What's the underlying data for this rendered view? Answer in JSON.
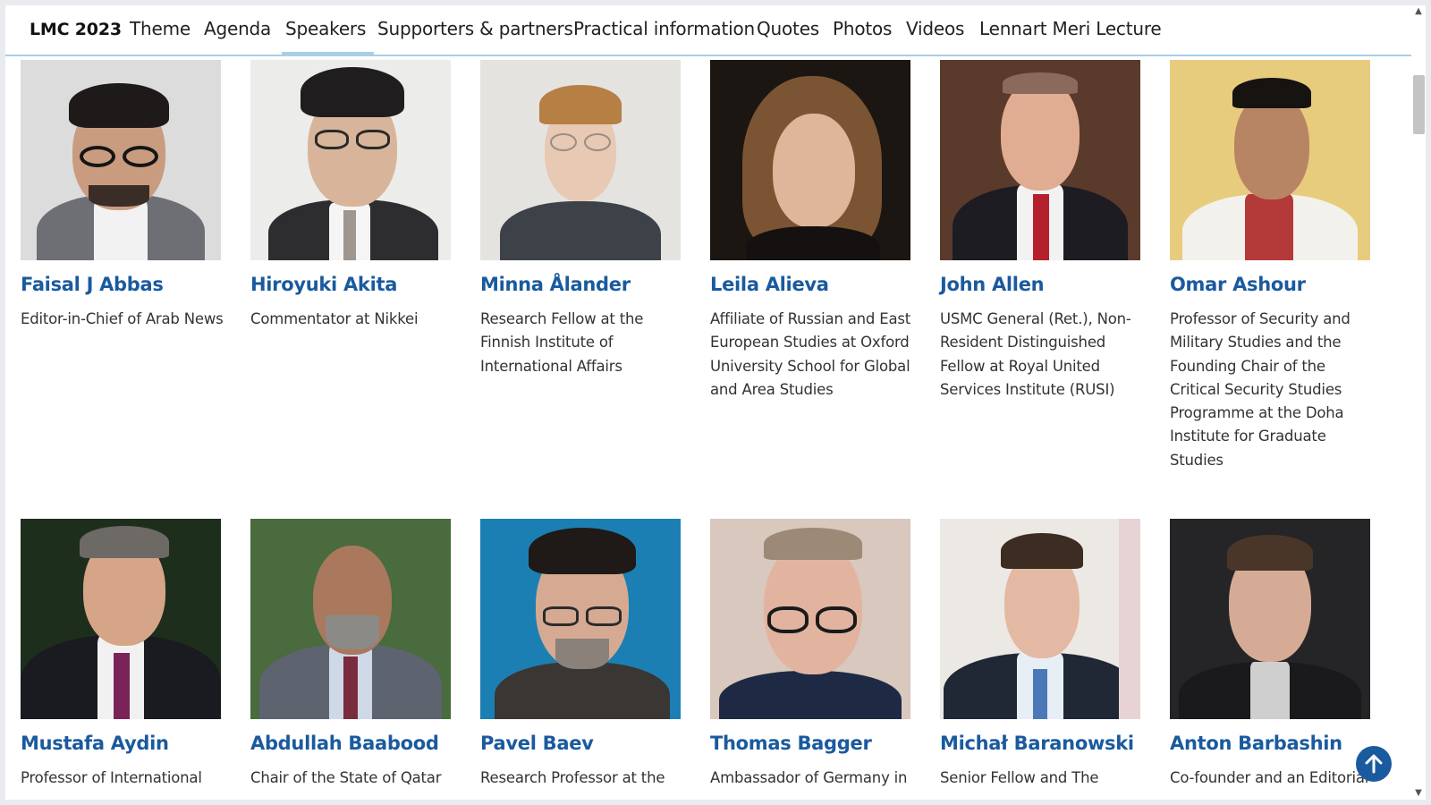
{
  "nav": {
    "brand": "LMC 2023",
    "items": [
      "Theme",
      "Agenda",
      "Speakers",
      "Supporters & partners",
      "Practical information",
      "Quotes",
      "Photos",
      "Videos",
      "Lennart Meri Lecture"
    ],
    "active": "Speakers",
    "accent_color": "#a9cfe8"
  },
  "speakers": [
    {
      "name": "Faisal J Abbas",
      "role": "Editor-in-Chief of Arab News"
    },
    {
      "name": "Hiroyuki Akita",
      "role": "Commentator at Nikkei"
    },
    {
      "name": "Minna Ålander",
      "role": "Research Fellow at the Finnish Institute of International Affairs"
    },
    {
      "name": "Leila Alieva",
      "role": "Affiliate of Russian and East European Studies at Oxford University School for Global and Area Studies"
    },
    {
      "name": "John Allen",
      "role": "USMC General (Ret.), Non-Resident Distinguished Fellow at Royal United Services Institute (RUSI)"
    },
    {
      "name": "Omar Ashour",
      "role": "Professor of Security and Military Studies and the Founding Chair of the Critical Security Studies Programme at the Doha Institute for Graduate Studies"
    },
    {
      "name": "Mustafa Aydin",
      "role": "Professor of International"
    },
    {
      "name": "Abdullah Baabood",
      "role": "Chair of the State of Qatar"
    },
    {
      "name": "Pavel Baev",
      "role": "Research Professor at the"
    },
    {
      "name": "Thomas Bagger",
      "role": "Ambassador of Germany in"
    },
    {
      "name": "Michał Baranowski",
      "role": "Senior Fellow and The"
    },
    {
      "name": "Anton Barbashin",
      "role": "Co-founder and an Editorial"
    }
  ],
  "colors": {
    "name_link": "#1a5a9e",
    "back_to_top": "#1a5a9e"
  },
  "icons": {
    "back_to_top": "arrow-up-icon"
  }
}
